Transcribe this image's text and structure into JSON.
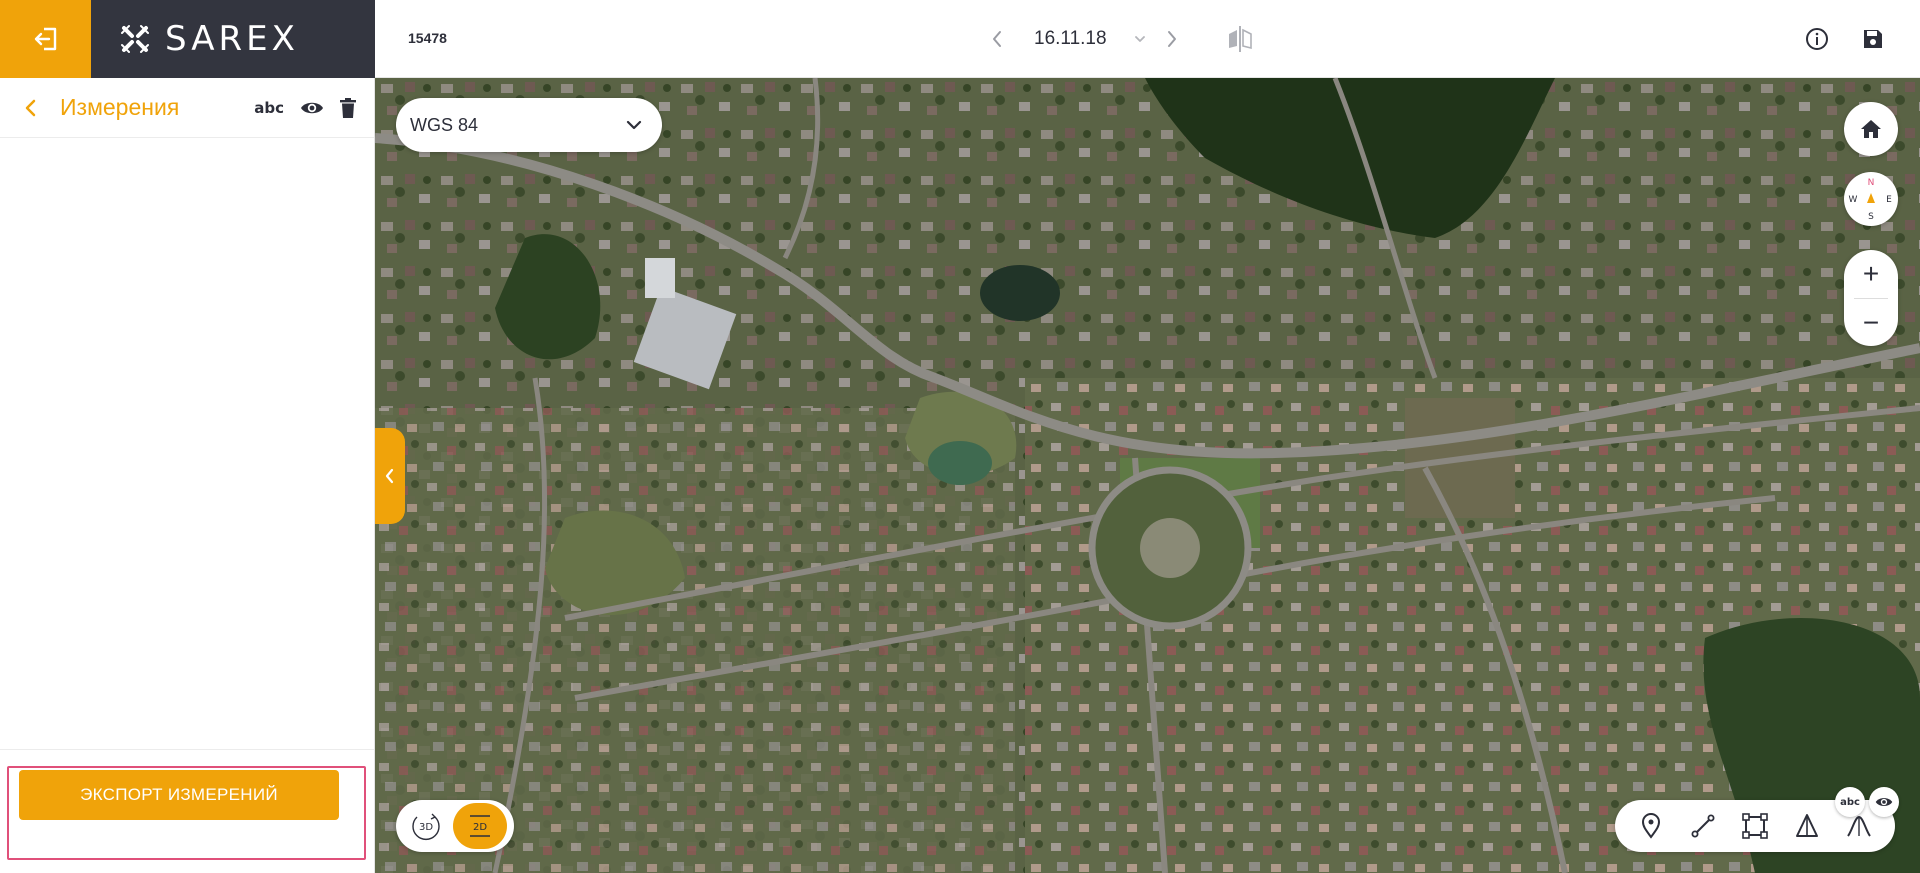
{
  "brand": {
    "name": "SAREX"
  },
  "panel": {
    "title": "Измерения",
    "abc_label": "abc",
    "export_label": "ЭКСПОРТ ИЗМЕРЕНИЙ"
  },
  "topbar": {
    "object_id": "15478",
    "date": "16.11.18"
  },
  "map": {
    "crs": "WGS 84",
    "compass": {
      "n": "N",
      "s": "S",
      "e": "E",
      "w": "W"
    },
    "zoom_in": "+",
    "zoom_out": "−",
    "mode_3d": "3D",
    "mode_2d": "2D",
    "badge_abc": "abc"
  },
  "colors": {
    "accent": "#f0a30a",
    "brand_dark": "#33353f",
    "focus": "#e0507a",
    "text": "#2d2f3a"
  },
  "icons": [
    "exit-icon",
    "sarex-logo-icon",
    "chevron-left-icon",
    "abc-label-icon",
    "eye-icon",
    "trash-icon",
    "info-icon",
    "save-icon",
    "compare-icon",
    "home-icon",
    "compass-icon",
    "point-tool-icon",
    "line-tool-icon",
    "area-tool-icon",
    "height-tool-icon",
    "profile-tool-icon"
  ]
}
